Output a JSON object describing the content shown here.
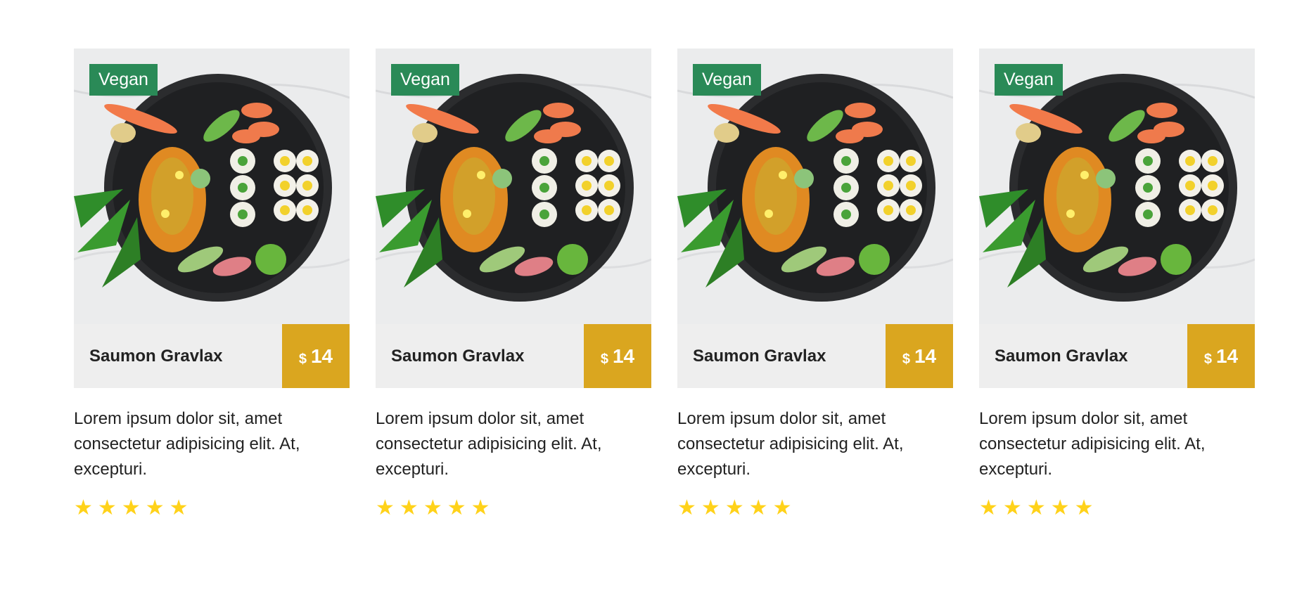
{
  "colors": {
    "badge": "#2a8a57",
    "price": "#daa61f",
    "title_bar": "#eeeeee",
    "star": "#ffd21a"
  },
  "cards": [
    {
      "badge": "Vegan",
      "title": "Saumon Gravlax",
      "currency": "$",
      "price": "14",
      "description": "Lorem ipsum dolor sit, amet consectetur adipisicing elit. At, excepturi.",
      "rating": 5,
      "image_icon": "sushi-platter-image"
    },
    {
      "badge": "Vegan",
      "title": "Saumon Gravlax",
      "currency": "$",
      "price": "14",
      "description": "Lorem ipsum dolor sit, amet consectetur adipisicing elit. At, excepturi.",
      "rating": 5,
      "image_icon": "sushi-platter-image"
    },
    {
      "badge": "Vegan",
      "title": "Saumon Gravlax",
      "currency": "$",
      "price": "14",
      "description": "Lorem ipsum dolor sit, amet consectetur adipisicing elit. At, excepturi.",
      "rating": 5,
      "image_icon": "sushi-platter-image"
    },
    {
      "badge": "Vegan",
      "title": "Saumon Gravlax",
      "currency": "$",
      "price": "14",
      "description": "Lorem ipsum dolor sit, amet consectetur adipisicing elit. At, excepturi.",
      "rating": 5,
      "image_icon": "sushi-platter-image"
    }
  ]
}
